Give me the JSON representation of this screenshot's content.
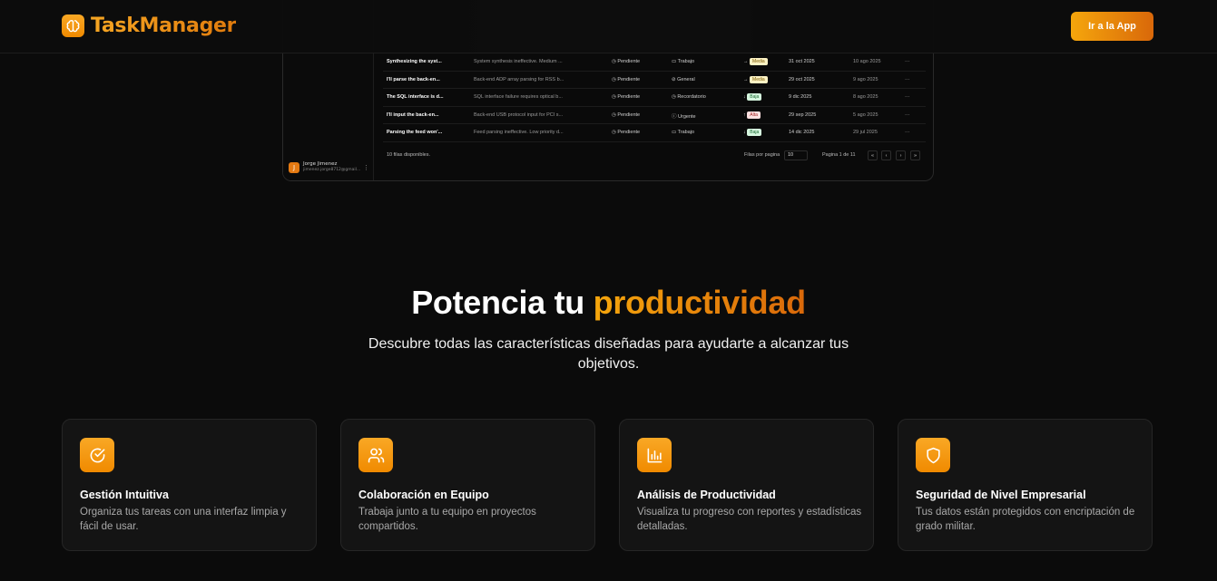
{
  "header": {
    "brand": "TaskManager",
    "cta_label": "Ir a la App"
  },
  "preview": {
    "user": {
      "initial": "J",
      "name": "Jorge Jimenez",
      "email": "jimenez.jorge8712@gmail..."
    },
    "rows": [
      {
        "title": "Synthesizing the syst...",
        "description": "System synthesis ineffective. Medium ...",
        "status": "Pendiente",
        "label": "Trabajo",
        "priority": "Media",
        "priority_class": "b-media",
        "arrow": "→",
        "due": "31 oct 2025",
        "created": "10 ago 2025"
      },
      {
        "title": "I'll parse the back-en...",
        "description": "Back-end ADP array parsing for RSS b...",
        "status": "Pendiente",
        "label": "General",
        "priority": "Media",
        "priority_class": "b-media",
        "arrow": "→",
        "due": "29 oct 2025",
        "created": "9 ago 2025"
      },
      {
        "title": "The SQL interface is d...",
        "description": "SQL interface failure requires optical b...",
        "status": "Pendiente",
        "label": "Recordatorio",
        "priority": "Baja",
        "priority_class": "b-baja",
        "arrow": "↓",
        "due": "9 dic 2025",
        "created": "8 ago 2025"
      },
      {
        "title": "I'll input the back-en...",
        "description": "Back-end USB protocol input for PCI s...",
        "status": "Pendiente",
        "label": "Urgente",
        "priority": "Alta",
        "priority_class": "b-alta",
        "arrow": "↑",
        "due": "29 sep 2025",
        "created": "5 ago 2025"
      },
      {
        "title": "Parsing the feed won'...",
        "description": "Feed parsing ineffective. Low priority d...",
        "status": "Pendiente",
        "label": "Trabajo",
        "priority": "Baja",
        "priority_class": "b-baja",
        "arrow": "↓",
        "due": "14 dic 2025",
        "created": "29 jul 2025"
      }
    ],
    "footer": {
      "rows_available": "10 filas disponibles.",
      "rows_per_page_label": "Filas por pagina",
      "rows_per_page_value": "10",
      "page_info": "Pagina 1 de 11",
      "first": "«",
      "prev": "‹",
      "next": "›",
      "last": "»"
    }
  },
  "hero": {
    "title_prefix": "Potencia tu",
    "title_accent": "productividad",
    "subtitle": "Descubre todas las características diseñadas para ayudarte a alcanzar tus objetivos."
  },
  "features": [
    {
      "icon": "check-circle-icon",
      "title": "Gestión Intuitiva",
      "description": "Organiza tus tareas con una interfaz limpia y fácil de usar."
    },
    {
      "icon": "users-icon",
      "title": "Colaboración en Equipo",
      "description": "Trabaja junto a tu equipo en proyectos compartidos."
    },
    {
      "icon": "bar-chart-icon",
      "title": "Análisis de Productividad",
      "description": "Visualiza tu progreso con reportes y estadísticas detalladas."
    },
    {
      "icon": "shield-icon",
      "title": "Seguridad de Nivel Empresarial",
      "description": "Tus datos están protegidos con encriptación de grado militar."
    }
  ],
  "colors": {
    "accent": "#f5a60c",
    "accent_dark": "#d9680a",
    "background": "#0b0b0b",
    "card": "#141414"
  }
}
